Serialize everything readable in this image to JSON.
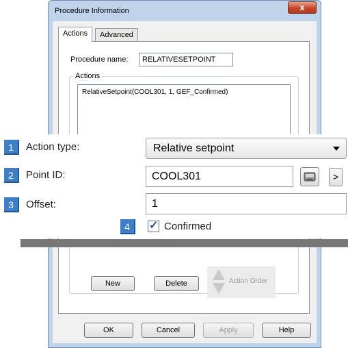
{
  "window": {
    "title": "Procedure Information",
    "close_glyph": "x"
  },
  "tabs": [
    {
      "label": "Actions",
      "active": true
    },
    {
      "label": "Advanced",
      "active": false
    }
  ],
  "procedure": {
    "name_label": "Procedure name:",
    "name_value": "RELATIVESETPOINT"
  },
  "actions_group": {
    "label": "Actions",
    "items": [
      "RelativeSetpoint(COOL301, 1, GEF_Confirmed)"
    ]
  },
  "action_buttons": {
    "new": "New",
    "delete": "Delete",
    "order": "Action Order"
  },
  "footer": {
    "ok": "OK",
    "cancel": "Cancel",
    "apply": "Apply",
    "help": "Help"
  },
  "callouts": {
    "action_type": {
      "num": "1",
      "label": "Action type:",
      "value": "Relative setpoint"
    },
    "point_id": {
      "num": "2",
      "label": "Point ID:",
      "value": "COOL301",
      "browse_glyph": ">"
    },
    "offset": {
      "num": "3",
      "label": "Offset:",
      "value": "1"
    },
    "confirmed": {
      "num": "4",
      "label": "Confirmed",
      "checked": true,
      "check_glyph": "✓"
    }
  },
  "colors": {
    "callout_badge": "#3e7fc8",
    "divider": "#777777",
    "window_frame": "#bfd3ea"
  },
  "icons": {
    "point_browser": "point-browser-icon"
  }
}
